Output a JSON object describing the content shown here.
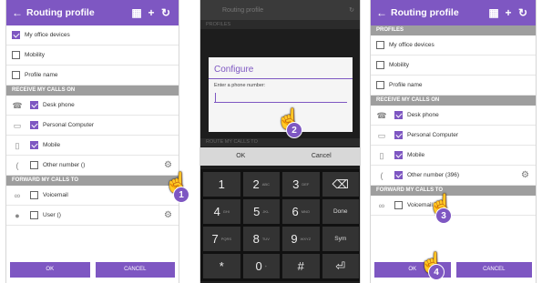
{
  "panel1": {
    "title": "Routing profile",
    "rows_top": [
      {
        "label": "My office devices",
        "checked": true
      },
      {
        "label": "Mobility",
        "checked": false
      },
      {
        "label": "Profile name",
        "checked": false
      }
    ],
    "section_receive": "RECEIVE MY CALLS ON",
    "receive": [
      {
        "label": "Desk phone",
        "checked": true,
        "icon": "desk-phone-icon"
      },
      {
        "label": "Personal Computer",
        "checked": true,
        "icon": "computer-icon"
      },
      {
        "label": "Mobile",
        "checked": true,
        "icon": "mobile-icon"
      },
      {
        "label": "Other number ()",
        "checked": false,
        "icon": "phone-handset-icon"
      }
    ],
    "section_forward": "FORWARD MY CALLS TO",
    "forward": [
      {
        "label": "Voicemail",
        "checked": false,
        "icon": "voicemail-icon"
      },
      {
        "label": "User ()",
        "checked": false,
        "icon": "user-icon"
      }
    ],
    "ok": "OK",
    "cancel": "CANCEL",
    "step": "1"
  },
  "panel2": {
    "title": "Routing profile",
    "section_profiles": "PROFILES",
    "dialog_title": "Configure",
    "prompt": "Enter a phone number:",
    "section_route": "ROUTE MY CALLS TO",
    "ok": "OK",
    "cancel": "Cancel",
    "keys": [
      {
        "k": "1",
        "s": ""
      },
      {
        "k": "2",
        "s": "ABC"
      },
      {
        "k": "3",
        "s": "DEF"
      },
      {
        "k": "⌫",
        "s": ""
      },
      {
        "k": "4",
        "s": "GHI"
      },
      {
        "k": "5",
        "s": "JKL"
      },
      {
        "k": "6",
        "s": "MNO"
      },
      {
        "k": "Done",
        "s": ""
      },
      {
        "k": "7",
        "s": "PQRS"
      },
      {
        "k": "8",
        "s": "TUV"
      },
      {
        "k": "9",
        "s": "WXYZ"
      },
      {
        "k": "Sym",
        "s": ""
      },
      {
        "k": "*",
        "s": ""
      },
      {
        "k": "0",
        "s": "+"
      },
      {
        "k": "#",
        "s": ""
      },
      {
        "k": "⏎",
        "s": ""
      }
    ],
    "step": "2"
  },
  "panel3": {
    "title": "Routing profile",
    "section_profiles": "PROFILES",
    "rows_top": [
      {
        "label": "My office devices",
        "checked": false
      },
      {
        "label": "Mobility",
        "checked": false
      },
      {
        "label": "Profile name",
        "checked": false
      }
    ],
    "section_receive": "RECEIVE MY CALLS ON",
    "receive": [
      {
        "label": "Desk phone",
        "checked": true,
        "icon": "desk-phone-icon"
      },
      {
        "label": "Personal Computer",
        "checked": true,
        "icon": "computer-icon"
      },
      {
        "label": "Mobile",
        "checked": true,
        "icon": "mobile-icon"
      },
      {
        "label": "Other number (396)",
        "checked": true,
        "icon": "phone-handset-icon"
      }
    ],
    "section_forward": "FORWARD MY CALLS TO",
    "forward": [
      {
        "label": "Voicemail",
        "checked": false,
        "icon": "voicemail-icon"
      }
    ],
    "ok": "OK",
    "cancel": "CANCEL",
    "step3": "3",
    "step4": "4"
  },
  "colors": {
    "accent": "#7e57c2",
    "section": "#9e9e9e"
  }
}
